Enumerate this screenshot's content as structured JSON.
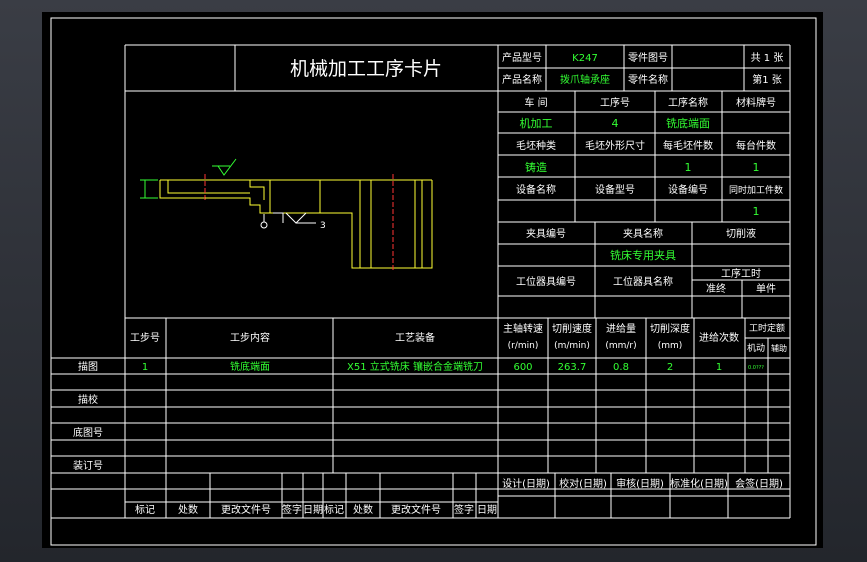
{
  "title": "机械加工工序卡片",
  "header": {
    "product_model_label": "产品型号",
    "product_model": "K247",
    "part_drawing_label": "零件图号",
    "part_drawing": "",
    "total_pages": "共 1 张",
    "product_name_label": "产品名称",
    "product_name": "拨爪轴承座",
    "part_name_label": "零件名称",
    "part_name": "",
    "page_no": "第1 张"
  },
  "info": {
    "workshop_label": "车 间",
    "process_no_label": "工序号",
    "process_name_label": "工序名称",
    "material_label": "材料牌号",
    "workshop": "机加工",
    "process_no": "4",
    "process_name": "铣底端面",
    "material": "",
    "blank_type_label": "毛坯种类",
    "blank_size_label": "毛坯外形尺寸",
    "per_blank_label": "每毛坯件数",
    "per_unit_label": "每台件数",
    "blank_type": "铸造",
    "blank_size": "",
    "per_blank": "1",
    "per_unit": "1",
    "equip_name_label": "设备名称",
    "equip_model_label": "设备型号",
    "equip_no_label": "设备编号",
    "simul_label": "同时加工件数",
    "equip_name": "",
    "equip_model": "",
    "equip_no": "",
    "simul": "1",
    "fixture_no_label": "夹具编号",
    "fixture_name_label": "夹具名称",
    "coolant_label": "切削液",
    "fixture_no": "",
    "fixture_name": "铣床专用夹具",
    "coolant": "",
    "station_tool_no_label": "工位器具编号",
    "station_tool_name_label": "工位器具名称",
    "proc_time_label": "工序工时",
    "prep_label": "准终",
    "unit_label": "单件"
  },
  "sketch": {
    "dim_label": "3"
  },
  "steps_header": {
    "step_no": "工步号",
    "content": "工步内容",
    "equipment": "工艺装备",
    "spindle": "主轴转速",
    "spindle_unit": "(r/min)",
    "cut_speed": "切削速度",
    "cut_speed_unit": "(m/min)",
    "feed": "进给量",
    "feed_unit": "(mm/r)",
    "depth": "切削深度",
    "depth_unit": "(mm)",
    "passes": "进给次数",
    "time_quota": "工时定额",
    "machine": "机动",
    "aux": "辅助"
  },
  "steps": [
    {
      "no": "1",
      "content": "铣底端面",
      "equipment": "X51 立式铣床 镶嵌合金端铣刀",
      "spindle": "600",
      "speed": "263.7",
      "feed": "0.8",
      "depth": "2",
      "passes": "1",
      "machine": "0.0???"
    }
  ],
  "left_labels": {
    "trace": "描图",
    "check": "描校",
    "base_no": "底图号",
    "binding_no": "装订号"
  },
  "sign": {
    "design": "设计(日期)",
    "review": "校对(日期)",
    "audit": "审核(日期)",
    "standard": "标准化(日期)",
    "countersign": "会签(日期)"
  },
  "revision": {
    "mark": "标记",
    "count": "处数",
    "doc_no": "更改文件号",
    "signature": "签字",
    "date": "日期"
  }
}
